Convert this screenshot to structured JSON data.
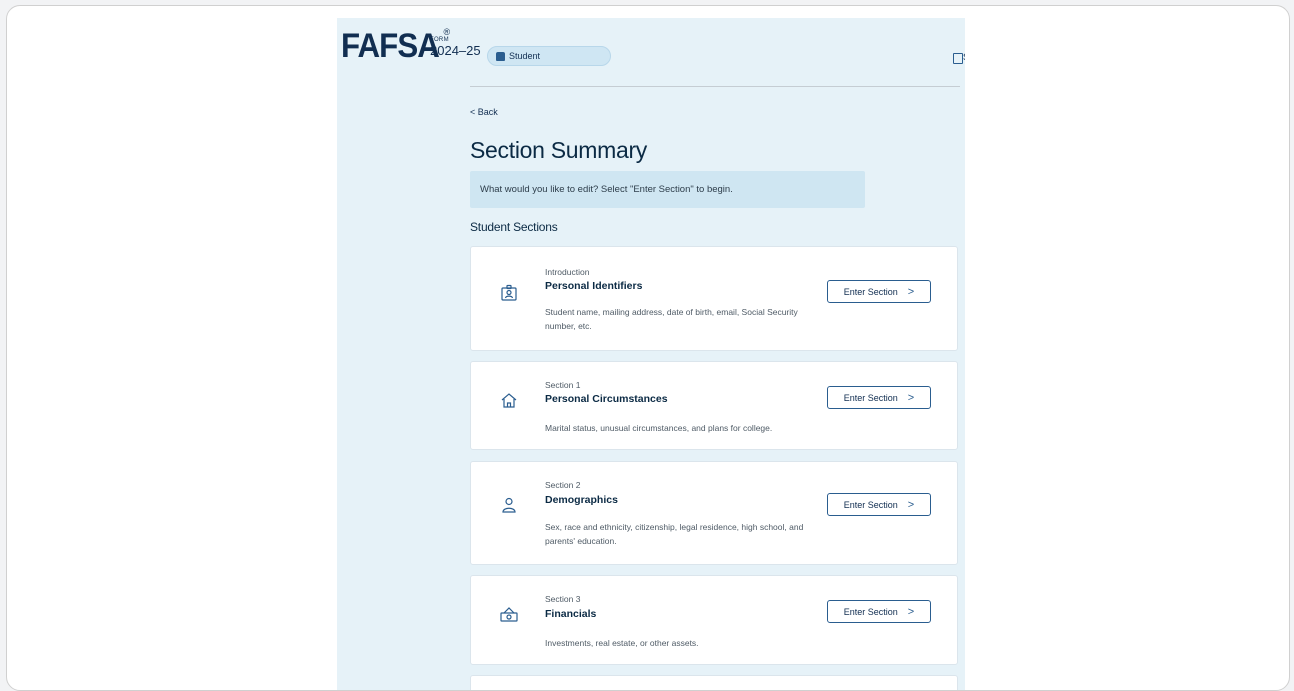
{
  "header": {
    "logo_text": "FAFSA",
    "logo_reg": "®",
    "form_label": "FORM",
    "form_year": "2024–25",
    "role_label": "Student",
    "save_label": "S"
  },
  "nav": {
    "back_label": "< Back"
  },
  "page": {
    "title": "Section Summary",
    "notice": "What would you like to edit? Select \"Enter Section\" to begin.",
    "sections_heading": "Student Sections"
  },
  "sections": [
    {
      "kicker": "Introduction",
      "title": "Personal Identifiers",
      "description": "Student name, mailing address, date of birth, email, Social Security number, etc.",
      "button": "Enter Section",
      "icon": "id-card-icon"
    },
    {
      "kicker": "Section 1",
      "title": "Personal Circumstances",
      "description": "Marital status, unusual circumstances, and plans for college.",
      "button": "Enter Section",
      "icon": "home-icon"
    },
    {
      "kicker": "Section 2",
      "title": "Demographics",
      "description": "Sex, race and ethnicity, citizenship, legal residence, high school, and parents' education.",
      "button": "Enter Section",
      "icon": "person-icon"
    },
    {
      "kicker": "Section 3",
      "title": "Financials",
      "description": "Investments, real estate, or other assets.",
      "button": "Enter Section",
      "icon": "money-icon"
    }
  ],
  "colors": {
    "page_bg": "#e6f2f8",
    "brand": "#112e51",
    "accent": "#2a5d8f"
  }
}
